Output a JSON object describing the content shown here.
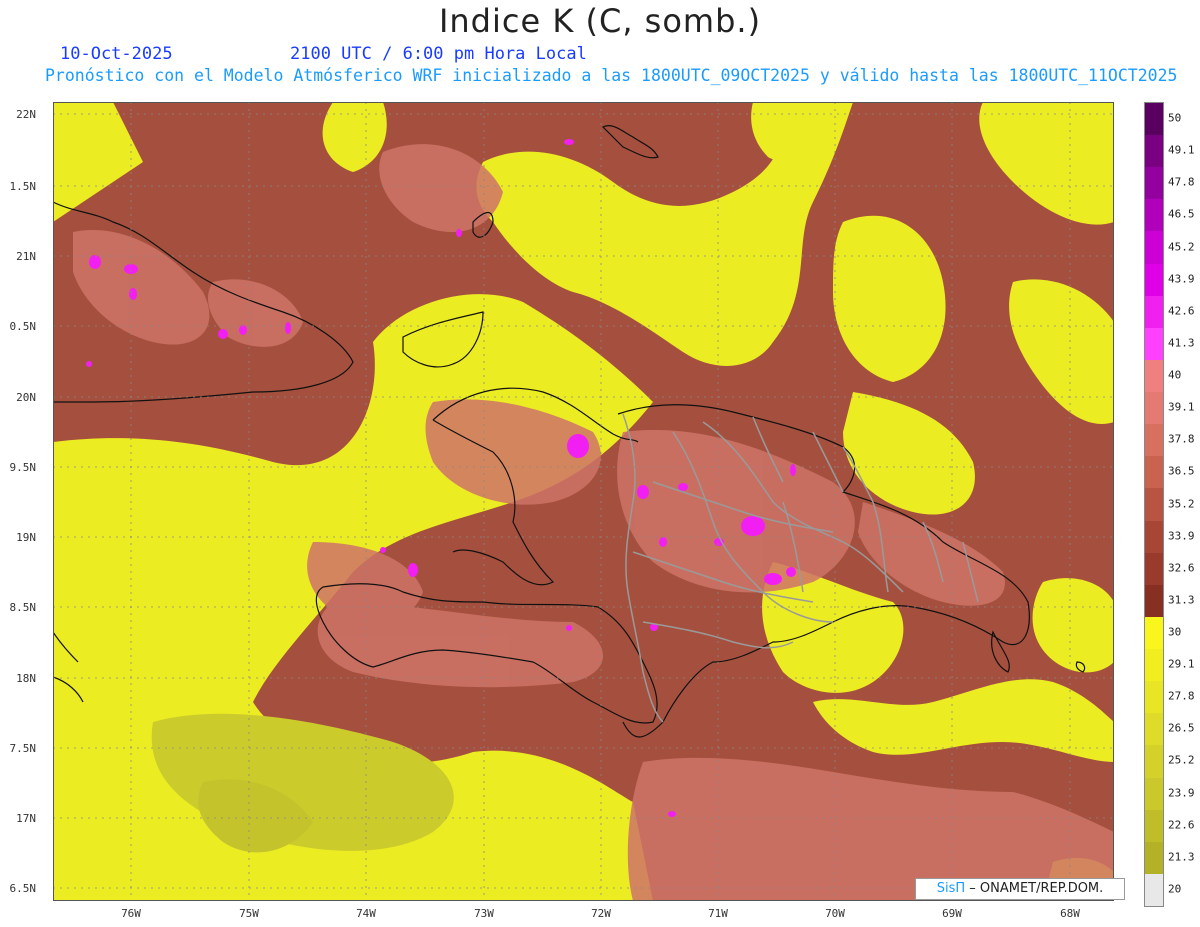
{
  "title": "Indice K (C, somb.)",
  "date": "10-Oct-2025",
  "valid_time": "2100 UTC / 6:00 pm Hora Local",
  "forecast_info": "Pronóstico con el Modelo Atmósferico WRF inicializado a las 1800UTC_09OCT2025 y válido hasta las  1800UTC_11OCT2025",
  "lat_labels": [
    "22N",
    "1.5N",
    "21N",
    "0.5N",
    "20N",
    "9.5N",
    "19N",
    "8.5N",
    "18N",
    "7.5N",
    "17N",
    "6.5N"
  ],
  "lon_labels": [
    "76W",
    "75W",
    "74W",
    "73W",
    "72W",
    "71W",
    "70W",
    "69W",
    "68W"
  ],
  "colorbar": {
    "labels": [
      "50",
      "49.1",
      "47.8",
      "46.5",
      "45.2",
      "43.9",
      "42.6",
      "41.3",
      "40",
      "39.1",
      "37.8",
      "36.5",
      "35.2",
      "33.9",
      "32.6",
      "31.3",
      "30",
      "29.1",
      "27.8",
      "26.5",
      "25.2",
      "23.9",
      "22.6",
      "21.3",
      "20"
    ],
    "colors": [
      "#5a0060",
      "#7a0082",
      "#9400a0",
      "#b000bc",
      "#cc00d4",
      "#e000e8",
      "#f020f0",
      "#ff40ff",
      "#f08080",
      "#e47a72",
      "#d8705f",
      "#c9624f",
      "#b95442",
      "#a84636",
      "#983a2c",
      "#873022",
      "#f8f61c",
      "#f0ee1f",
      "#e8e624",
      "#dedc28",
      "#d4d22a",
      "#cac82a",
      "#bfbd28",
      "#b3b226",
      "#e8e8e8"
    ]
  },
  "credit": {
    "brand": "SisΠ",
    "org": "– ONAMET/REP.DOM."
  },
  "colors": {
    "warm": "#a5503e",
    "hot": "#cf7468",
    "dry": "#ecec23",
    "very_dry": "#cccb2c",
    "max": "#f21ff2"
  }
}
